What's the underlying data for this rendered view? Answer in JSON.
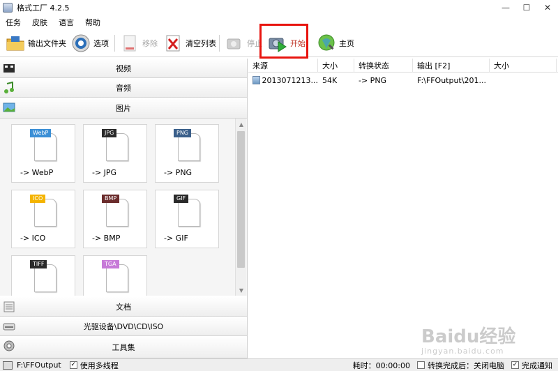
{
  "window": {
    "title": "格式工厂 4.2.5",
    "minimize": "—",
    "maximize": "☐",
    "close": "✕"
  },
  "menu": [
    "任务",
    "皮肤",
    "语言",
    "帮助"
  ],
  "toolbar": {
    "output_folder": "输出文件夹",
    "options": "选项",
    "remove": "移除",
    "clear_list": "清空列表",
    "stop": "停止",
    "start": "开始",
    "home": "主页"
  },
  "categories": {
    "video": "视频",
    "audio": "音频",
    "image": "图片",
    "document": "文档",
    "optical": "光驱设备\\DVD\\CD\\ISO",
    "tools": "工具集"
  },
  "formats": [
    {
      "badge": "WebP",
      "label": "-> WebP",
      "color": "#3b8fd6"
    },
    {
      "badge": "JPG",
      "label": "-> JPG",
      "color": "#2a2a2a"
    },
    {
      "badge": "PNG",
      "label": "-> PNG",
      "color": "#3a5f8a"
    },
    {
      "badge": "ICO",
      "label": "-> ICO",
      "color": "#f4b400"
    },
    {
      "badge": "BMP",
      "label": "-> BMP",
      "color": "#6b2c2c"
    },
    {
      "badge": "GIF",
      "label": "-> GIF",
      "color": "#2a2a2a"
    },
    {
      "badge": "TIFF",
      "label": "",
      "color": "#2a2a2a"
    },
    {
      "badge": "TGA",
      "label": "",
      "color": "#c77ad8"
    }
  ],
  "list": {
    "columns": [
      "来源",
      "大小",
      "转换状态",
      "输出 [F2]",
      "大小"
    ],
    "rows": [
      {
        "source": "2013071213...",
        "size": "54K",
        "status": "-> PNG",
        "output": "F:\\FFOutput\\201...",
        "out_size": ""
      }
    ]
  },
  "status": {
    "output_path": "F:\\FFOutput",
    "multithread": "使用多线程",
    "elapsed": "耗时：00:00:00",
    "shutdown": "转换完成后：关闭电脑",
    "notify": "完成通知"
  },
  "watermark": {
    "main": "Baidu经验",
    "sub": "jingyan.baidu.com"
  },
  "colors": {
    "highlight_border": "#e8140e",
    "start_label": "#c0392b"
  }
}
